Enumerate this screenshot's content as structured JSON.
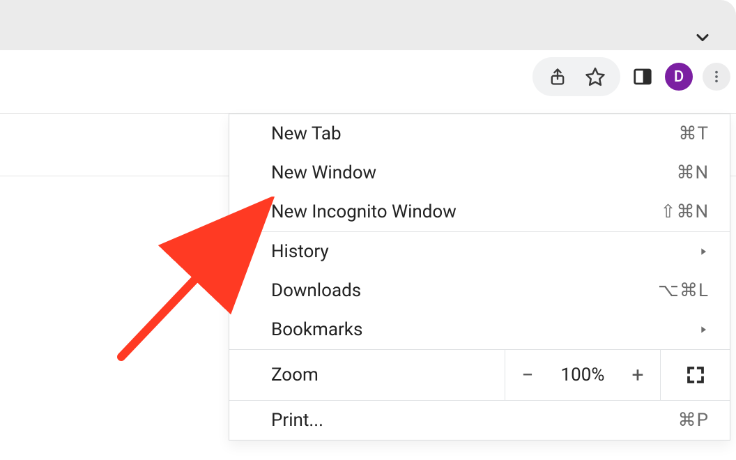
{
  "tabstrip": {},
  "toolbar": {
    "avatar_letter": "D"
  },
  "menu": {
    "section1": [
      {
        "label": "New Tab",
        "shortcut": "⌘T"
      },
      {
        "label": "New Window",
        "shortcut": "⌘N"
      },
      {
        "label": "New Incognito Window",
        "shortcut": "⇧⌘N"
      }
    ],
    "section2": [
      {
        "label": "History",
        "submenu": true
      },
      {
        "label": "Downloads",
        "shortcut": "⌥⌘L"
      },
      {
        "label": "Bookmarks",
        "submenu": true
      }
    ],
    "zoom": {
      "label": "Zoom",
      "value": "100%"
    },
    "section3": [
      {
        "label": "Print...",
        "shortcut": "⌘P"
      }
    ]
  },
  "colors": {
    "avatar": "#7b1fa2",
    "arrow": "#ff3a23"
  }
}
